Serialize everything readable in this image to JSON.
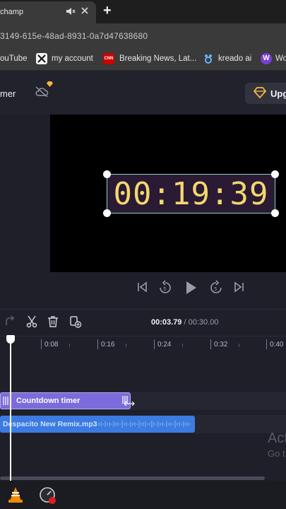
{
  "browser": {
    "tab_title": "champ",
    "url": "3149-615e-48ad-8931-0a7d47638680",
    "bookmarks": [
      {
        "label": "ouTube",
        "icon": "youtube-icon"
      },
      {
        "label": "my account",
        "icon": "x-icon"
      },
      {
        "label": "Breaking News, Lat...",
        "icon": "cnn-icon",
        "icon_text": "CNN"
      },
      {
        "label": "kreado ai",
        "icon": "kreado-icon"
      },
      {
        "label": "Wo",
        "icon": "w-icon",
        "icon_text": "W"
      }
    ]
  },
  "app": {
    "title": "mer",
    "upgrade_label": "Upg"
  },
  "preview": {
    "timer_text": "00:19:39"
  },
  "timeline": {
    "current_time": "00:03.79",
    "total_time": "/ 00:30.00",
    "ruler_labels": [
      "0:08",
      "0:16",
      "0:24",
      "0:32",
      "0:40"
    ],
    "clips": {
      "countdown_label": "Countdown timer",
      "audio_label": "Despacito New Remix.mp3"
    }
  },
  "overlay": {
    "activate_title": "Act",
    "activate_sub": "Go t"
  },
  "colors": {
    "timer_digits": "#f3d770",
    "countdown_clip": "#7b6bdc",
    "audio_clip": "#3c7be0",
    "accent_diamond": "#f3b53c"
  }
}
